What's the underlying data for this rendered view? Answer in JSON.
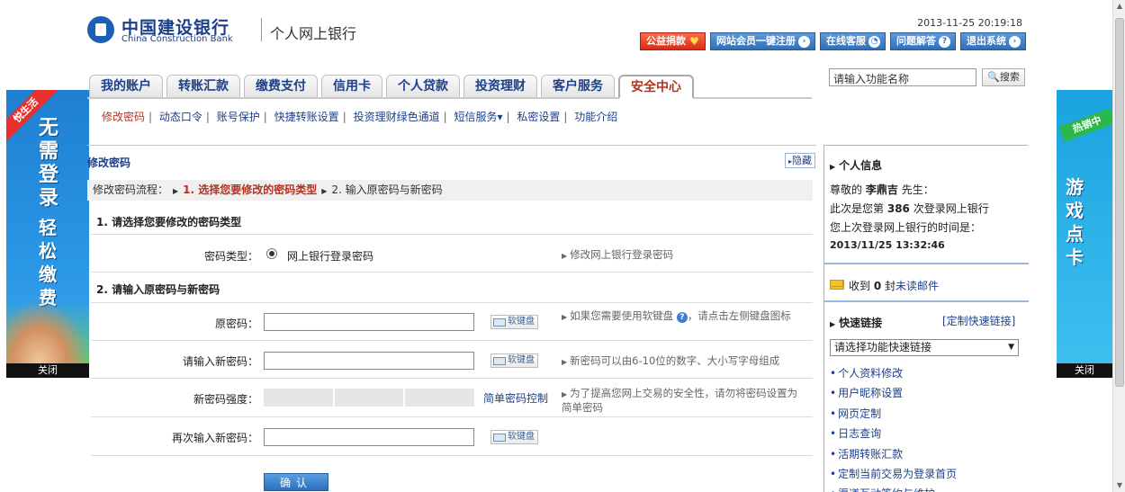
{
  "ads": {
    "left": {
      "ribbon": "悦生活",
      "text_col1": "无需登录",
      "text_col2": "轻松缴费",
      "close": "关闭"
    },
    "right": {
      "ribbon": "热销中",
      "text_col1": "游戏点卡",
      "close": "关闭"
    }
  },
  "header": {
    "logo_cn": "中国建设银行",
    "logo_en": "China Construction Bank",
    "subtitle": "个人网上银行",
    "datetime": "2013-11-25 20:19:18",
    "buttons": [
      "公益捐款",
      "网站会员一键注册",
      "在线客服",
      "问题解答",
      "退出系统"
    ]
  },
  "nav": {
    "tabs": [
      "我的账户",
      "转账汇款",
      "缴费支付",
      "信用卡",
      "个人贷款",
      "投资理财",
      "客户服务",
      "安全中心"
    ],
    "active_index": 7
  },
  "search": {
    "placeholder": "请输入功能名称",
    "button": "搜索"
  },
  "subnav": [
    "修改密码",
    "动态口令",
    "账号保护",
    "快捷转账设置",
    "投资理财绿色通道",
    "短信服务▾",
    "私密设置",
    "功能介绍"
  ],
  "content": {
    "section_title": "修改密码",
    "hide_btn": "隐藏",
    "flow_label": "修改密码流程：",
    "flow_step1": "1. 选择您要修改的密码类型",
    "flow_step2": "2. 输入原密码与新密码",
    "sec1_head": "1. 请选择您要修改的密码类型",
    "pw_type_label": "密码类型：",
    "pw_type_value": "网上银行登录密码",
    "pw_type_hint": "修改网上银行登录密码",
    "sec2_head": "2. 请输入原密码与新密码",
    "old_pw_label": "原密码：",
    "old_pw_hint_a": "如果您需要使用软键盘",
    "old_pw_hint_b": "，请点击左侧键盘图标",
    "new_pw_label": "请输入新密码：",
    "new_pw_hint": "新密码可以由6-10位的数字、大小写字母组成",
    "strength_label": "新密码强度：",
    "strength_link": "简单密码控制",
    "strength_hint": "为了提高您网上交易的安全性，请勿将密码设置为简单密码",
    "confirm_label": "再次输入新密码：",
    "keyboard_btn": "软键盘",
    "submit": "确认"
  },
  "sidebar": {
    "personal_title": "个人信息",
    "greeting_pre": "尊敬的",
    "user_name": "李鼎吉",
    "greeting_post": "先生：",
    "login_count_pre": "此次是您第",
    "login_count": "386",
    "login_count_post": "次登录网上银行",
    "last_login_label": "您上次登录网上银行的时间是：",
    "last_login_time": "2013/11/25 13:32:46",
    "mail_pre": "收到",
    "mail_count": "0",
    "mail_mid": "封",
    "mail_link": "未读邮件",
    "quick_title": "快速链接",
    "quick_custom": "[定制快速链接]",
    "quick_select": "请选择功能快速链接",
    "quick_links": [
      "个人资料修改",
      "用户昵称设置",
      "网页定制",
      "日志查询",
      "活期转账汇款",
      "定制当前交易为登录首页",
      "渠道互动签约与维护"
    ]
  }
}
